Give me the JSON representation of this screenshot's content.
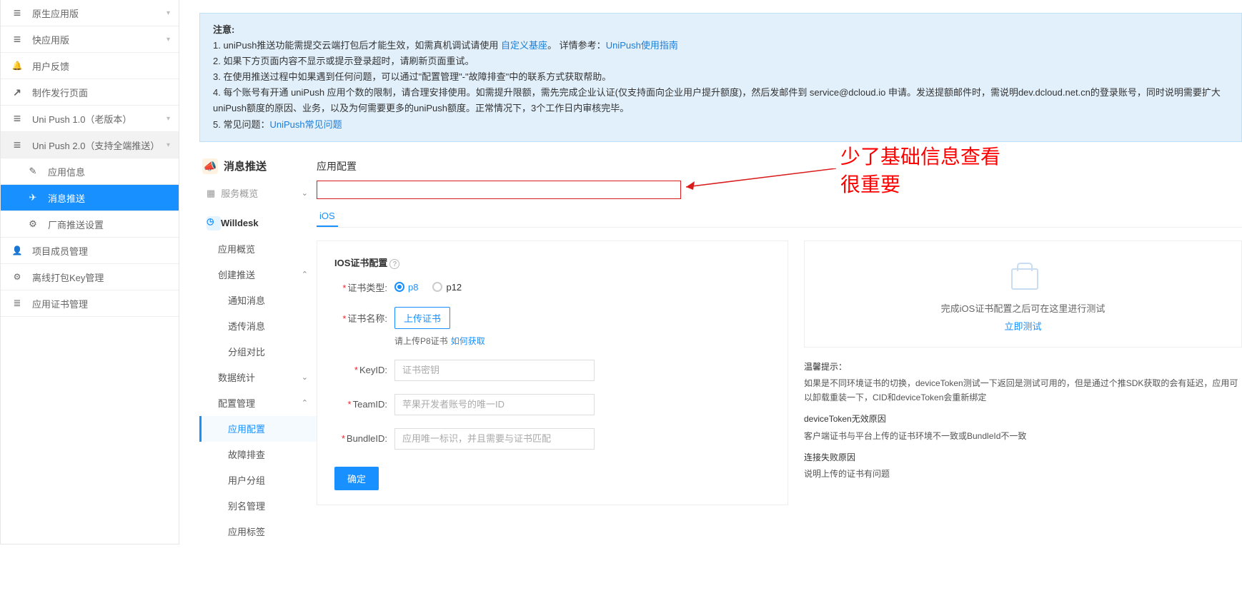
{
  "left_sidebar": {
    "items": [
      {
        "label": "原生应用版",
        "icon": "u-burger",
        "chevron": true
      },
      {
        "label": "快应用版",
        "icon": "u-burger",
        "chevron": true
      },
      {
        "label": "用户反馈",
        "icon": "u-bell"
      },
      {
        "label": "制作发行页面",
        "icon": "u-share"
      },
      {
        "label": "Uni Push 1.0（老版本）",
        "icon": "u-burger",
        "chevron": true
      },
      {
        "label": "Uni Push 2.0（支持全端推送）",
        "icon": "u-burger",
        "chevron": true,
        "active": true
      },
      {
        "label": "应用信息",
        "icon": "u-edit",
        "sub": true
      },
      {
        "label": "消息推送",
        "icon": "u-send",
        "sub": true,
        "selected": true
      },
      {
        "label": "厂商推送设置",
        "icon": "u-gear",
        "sub": true
      },
      {
        "label": "项目成员管理",
        "icon": "u-user"
      },
      {
        "label": "离线打包Key管理",
        "icon": "u-key"
      },
      {
        "label": "应用证书管理",
        "icon": "u-list"
      }
    ]
  },
  "notice": {
    "title": "注意:",
    "line1a": "1. uniPush推送功能需提交云端打包后才能生效，如需真机调试请使用 ",
    "line1_link1": "自定义基座",
    "line1b": "。 详情参考：",
    "line1_link2": "UniPush使用指南",
    "line2": "2. 如果下方页面内容不显示或提示登录超时，请刷新页面重试。",
    "line3": "3. 在使用推送过程中如果遇到任何问题，可以通过\"配置管理\"-\"故障排查\"中的联系方式获取帮助。",
    "line4": "4. 每个账号有开通 uniPush 应用个数的限制，请合理安排使用。如需提升限额，需先完成企业认证(仅支持面向企业用户提升额度)，然后发邮件到 service@dcloud.io 申请。发送提额邮件时，需说明dev.dcloud.net.cn的登录账号，同时说明需要扩大uniPush额度的原因、业务，以及为何需要更多的uniPush额度。正常情况下，3个工作日内审核完毕。",
    "line5a": "5. 常见问题：",
    "line5_link": "UniPush常见问题"
  },
  "mid": {
    "title": "消息推送",
    "service_overview": "服务概览",
    "willdesk": "Willdesk",
    "items": {
      "app_overview": "应用概览",
      "create_push": "创建推送",
      "notify_msg": "通知消息",
      "passthrough": "透传消息",
      "group_compare": "分组对比",
      "data_stats": "数据统计",
      "config_manage": "配置管理",
      "app_config": "应用配置",
      "fault_check": "故障排查",
      "user_group": "用户分组",
      "alias_manage": "别名管理",
      "app_tag": "应用标签"
    }
  },
  "panel": {
    "title": "应用配置",
    "tab_ios": "iOS",
    "card_title": "IOS证书配置",
    "cert_type_label": "证书类型:",
    "cert_type_p8": "p8",
    "cert_type_p12": "p12",
    "cert_name_label": "证书名称:",
    "upload_btn": "上传证书",
    "upload_hint": "请上传P8证书",
    "upload_link": "如何获取",
    "keyid_label": "KeyID:",
    "keyid_placeholder": "证书密钥",
    "teamid_label": "TeamID:",
    "teamid_placeholder": "苹果开发者账号的唯一ID",
    "bundleid_label": "BundleID:",
    "bundleid_placeholder": "应用唯一标识，并且需要与证书匹配",
    "submit": "确定"
  },
  "right": {
    "box1_msg": "完成iOS证书配置之后可在这里进行测试",
    "box1_link": "立即测试",
    "box2_title": "温馨提示：",
    "box2_p1": "如果是不同环境证书的切换，deviceToken测试一下返回是测试可用的，但是通过个推SDK获取的会有延迟，应用可以卸载重装一下，CID和deviceToken会重新绑定",
    "box2_p2h": "deviceToken无效原因",
    "box2_p2": "客户端证书与平台上传的证书环境不一致或BundleId不一致",
    "box2_p3h": "连接失败原因",
    "box2_p3": "说明上传的证书有问题"
  },
  "annotation": {
    "line1": "少了基础信息查看",
    "line2": "很重要"
  }
}
